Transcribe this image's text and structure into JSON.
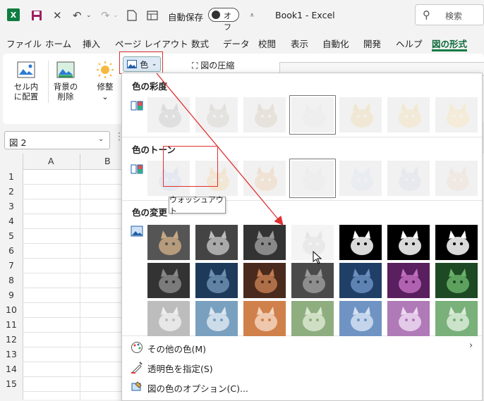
{
  "titlebar": {
    "app_logo": "X",
    "autosave_label": "自動保存",
    "toggle_state": "オフ",
    "doc_title": "Book1  -  Excel",
    "search_placeholder": "検索",
    "icons": [
      "save-icon",
      "close-icon",
      "undo-icon",
      "redo-icon",
      "new-doc-icon",
      "form-icon",
      "customize-arrow-icon",
      "search-icon"
    ]
  },
  "tabs": [
    "ファイル",
    "ホーム",
    "挿入",
    "ページ レイアウト",
    "数式",
    "データ",
    "校閲",
    "表示",
    "自動化",
    "開発",
    "ヘルプ",
    "図の形式"
  ],
  "active_tab": "図の形式",
  "ribbon": {
    "buttons": [
      {
        "line1": "セル内",
        "line2": "に配置"
      },
      {
        "line1": "背景の",
        "line2": "削除"
      },
      {
        "line1": "修整",
        "line2": "⌄"
      }
    ],
    "color_button_label": "色",
    "compress_label": "図の圧縮"
  },
  "namebox": {
    "value": "図 2"
  },
  "grid": {
    "columns": [
      "A",
      "B"
    ],
    "rows": [
      "1",
      "2",
      "3",
      "4",
      "5",
      "6",
      "7",
      "8",
      "9",
      "10",
      "11",
      "12",
      "13",
      "14",
      "15"
    ]
  },
  "panel": {
    "section_saturation": "色の彩度",
    "section_tone": "色のトーン",
    "section_recolor": "色の変更",
    "tooltip": "ウォッシュアウト",
    "menu": [
      {
        "label": "その他の色(M)",
        "icon": "palette-icon",
        "has_submenu": true
      },
      {
        "label": "透明色を指定(S)",
        "icon": "set-transparent-icon",
        "has_submenu": false
      },
      {
        "label": "図の色のオプション(C)...",
        "icon": "picture-color-options-icon",
        "has_submenu": false
      }
    ]
  },
  "colors": {
    "accent_green": "#107c41",
    "highlight_red": "#e03030"
  }
}
